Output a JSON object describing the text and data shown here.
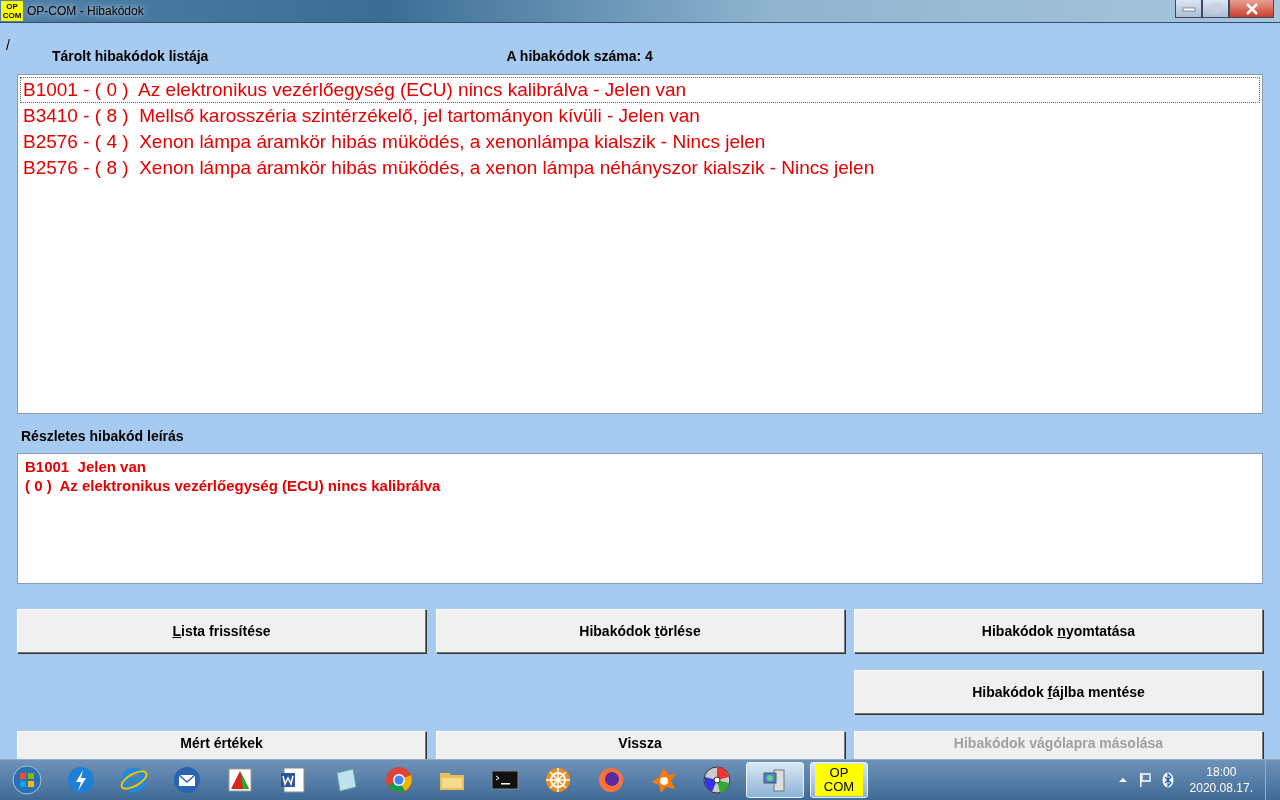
{
  "window": {
    "title": "OP-COM - Hibakódok",
    "icon_text": [
      "OP",
      "COM"
    ]
  },
  "marker": "/",
  "list_header": {
    "title": "Tárolt hibakódok listája",
    "count": "A hibakódok száma: 4"
  },
  "codes": [
    {
      "text": "B1001 - ( 0 )  Az elektronikus vezérlőegység (ECU) nincs kalibrálva - Jelen van",
      "selected": true
    },
    {
      "text": "B3410 - ( 8 )  Mellső karosszéria szintérzékelő, jel tartományon kívüli - Jelen van",
      "selected": false
    },
    {
      "text": "B2576 - ( 4 )  Xenon lámpa áramkör hibás müködés, a xenonlámpa kialszik - Nincs jelen",
      "selected": false
    },
    {
      "text": "B2576 - ( 8 )  Xenon lámpa áramkör hibás müködés, a xenon lámpa néhányszor kialszik - Nincs jelen",
      "selected": false
    }
  ],
  "detail": {
    "title": "Részletes hibakód leírás",
    "lines": [
      "B1001  Jelen van",
      "( 0 )  Az elektronikus vezérlőegység (ECU) nincs kalibrálva"
    ]
  },
  "buttons": [
    {
      "key": "L",
      "post": "ista frissítése",
      "disabled": false
    },
    {
      "pre": "Hibakódok ",
      "key": "t",
      "post": "örlése",
      "disabled": false
    },
    {
      "pre": "Hibakódok ",
      "key": "n",
      "post": "yomtatása",
      "disabled": false
    },
    {
      "pre": "Hibakódok ",
      "key": "f",
      "post": "ájlba mentése",
      "disabled": false
    },
    {
      "pre": "Mért értékek",
      "disabled": false
    },
    {
      "pre": "Vissza",
      "disabled": false
    },
    {
      "pre": "Hibakódok vágólapra másolása",
      "disabled": true
    }
  ],
  "taskbar": {
    "apps": [
      {
        "kind": "lightning",
        "active": false
      },
      {
        "kind": "browser-e",
        "active": false
      },
      {
        "kind": "mail",
        "active": false
      },
      {
        "kind": "chart",
        "active": false
      },
      {
        "kind": "word",
        "active": false
      },
      {
        "kind": "notepad",
        "active": false
      },
      {
        "kind": "chrome",
        "active": false
      },
      {
        "kind": "folder",
        "active": false
      },
      {
        "kind": "terminal",
        "active": false
      },
      {
        "kind": "gear",
        "active": false
      },
      {
        "kind": "firefox",
        "active": false
      },
      {
        "kind": "avast",
        "active": false
      },
      {
        "kind": "disc",
        "active": false
      },
      {
        "kind": "computer",
        "active": true
      },
      {
        "kind": "opcom",
        "active": true,
        "text": [
          "OP",
          "COM"
        ]
      }
    ],
    "time": "18:00",
    "date": "2020.08.17."
  }
}
